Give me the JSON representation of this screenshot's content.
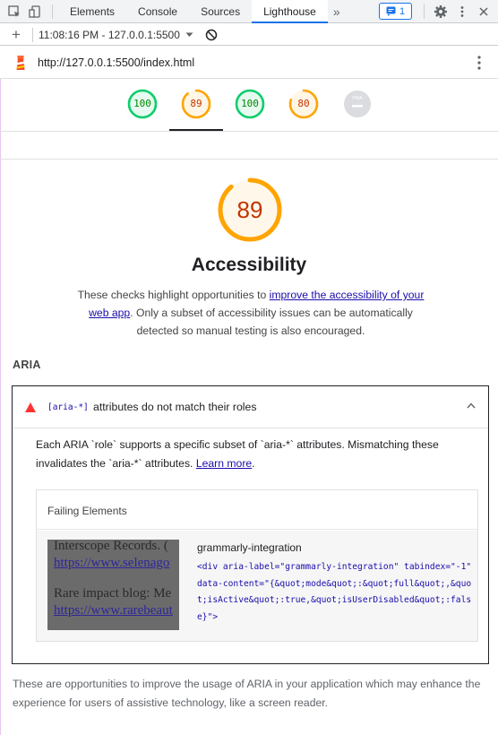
{
  "devtools": {
    "tabs": [
      "Elements",
      "Console",
      "Sources",
      "Lighthouse"
    ],
    "active_tab": "Lighthouse",
    "more_tabs_glyph": "»",
    "issues_count": "1",
    "toolbar_report": "11:08:16 PM - 127.0.0.1:5500",
    "add_glyph": "+"
  },
  "report": {
    "url": "http://127.0.0.1:5500/index.html",
    "gauges": [
      {
        "label": "100",
        "score": 100,
        "color": "#0cce6b",
        "text_color": "#008800"
      },
      {
        "label": "89",
        "score": 89,
        "color": "#ffa400",
        "text_color": "#c33300"
      },
      {
        "label": "100",
        "score": 100,
        "color": "#0cce6b",
        "text_color": "#008800"
      },
      {
        "label": "80",
        "score": 80,
        "color": "#ffa400",
        "text_color": "#c33300"
      },
      {
        "label": "PWA",
        "score": null,
        "color": "#dadce0",
        "text_color": "#ffffff"
      }
    ],
    "category": {
      "score": "89",
      "score_value": 89,
      "title": "Accessibility",
      "desc_before": "These checks highlight opportunities to ",
      "desc_link": "improve the accessibility of your web app",
      "desc_after": ". Only a subset of accessibility issues can be automatically detected so manual testing is also encouraged."
    },
    "group_title": "ARIA",
    "audit": {
      "code": "[aria-*]",
      "title": "attributes do not match their roles",
      "desc_text": "Each ARIA `role` supports a specific subset of `aria-*` attributes. Mismatching these invalidates the `aria-*` attributes. ",
      "desc_link": "Learn more",
      "desc_end": ".",
      "failing_header": "Failing Elements",
      "node_label": "grammarly-integration",
      "snippet": "<div aria-label=\"grammarly-integration\" tabindex=\"-1\" data-content=\"{&quot;mode&quot;:&quot;full&quot;,&quot;isActive&quot;:true,&quot;isUserDisabled&quot;:false}\">",
      "thumb_lines": [
        "Interscope Records. (",
        "https://www.selenago",
        "Rare impact blog: Me",
        "https://www.rarebeaut"
      ]
    },
    "group_footer": "These are opportunities to improve the usage of ARIA in your application which may enhance the experience for users of assistive technology, like a screen reader.",
    "colors": {
      "fail": "#ff3333",
      "average": "#ffa400",
      "pass": "#0cce6b",
      "link": "#1a0dab"
    }
  }
}
